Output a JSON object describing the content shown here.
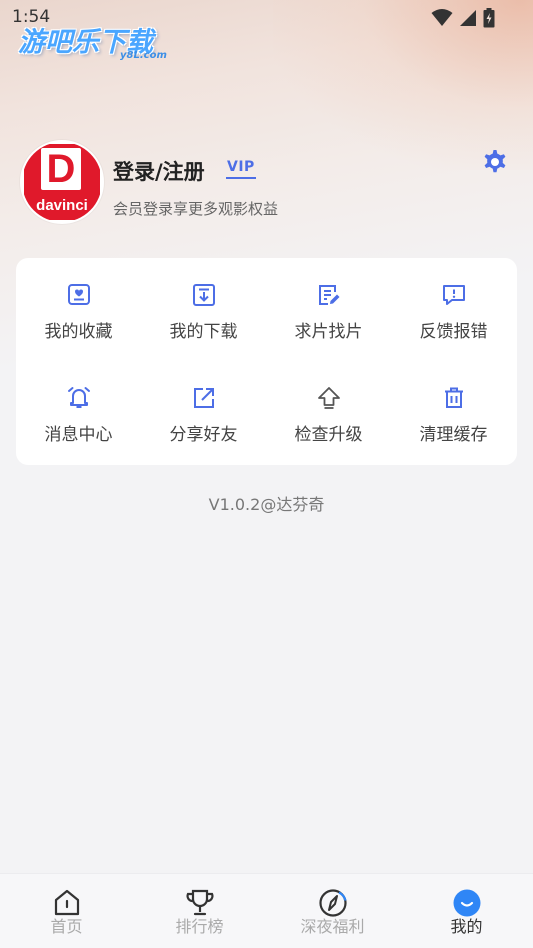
{
  "status_bar": {
    "time": "1:54"
  },
  "watermark": {
    "text": "游吧乐下载",
    "sub": "y8L.com"
  },
  "profile": {
    "avatar_brand": "davinci",
    "avatar_letter": "D",
    "title": "登录/注册",
    "vip": "VIP",
    "subtitle": "会员登录享更多观影权益"
  },
  "grid": {
    "items": [
      {
        "label": "我的收藏",
        "icon": "favorites-icon"
      },
      {
        "label": "我的下载",
        "icon": "download-icon"
      },
      {
        "label": "求片找片",
        "icon": "request-icon"
      },
      {
        "label": "反馈报错",
        "icon": "feedback-icon"
      },
      {
        "label": "消息中心",
        "icon": "bell-icon"
      },
      {
        "label": "分享好友",
        "icon": "share-icon"
      },
      {
        "label": "检查升级",
        "icon": "upgrade-icon"
      },
      {
        "label": "清理缓存",
        "icon": "trash-icon"
      }
    ]
  },
  "version": "V1.0.2@达芬奇",
  "bottom_nav": {
    "items": [
      {
        "label": "首页",
        "icon": "home-icon",
        "active": false
      },
      {
        "label": "排行榜",
        "icon": "trophy-icon",
        "active": false
      },
      {
        "label": "深夜福利",
        "icon": "compass-icon",
        "active": false
      },
      {
        "label": "我的",
        "icon": "profile-icon",
        "active": true
      }
    ]
  },
  "colors": {
    "accent": "#4d6ee6",
    "brand_red": "#e0192b",
    "active_blue": "#2f86f6"
  }
}
